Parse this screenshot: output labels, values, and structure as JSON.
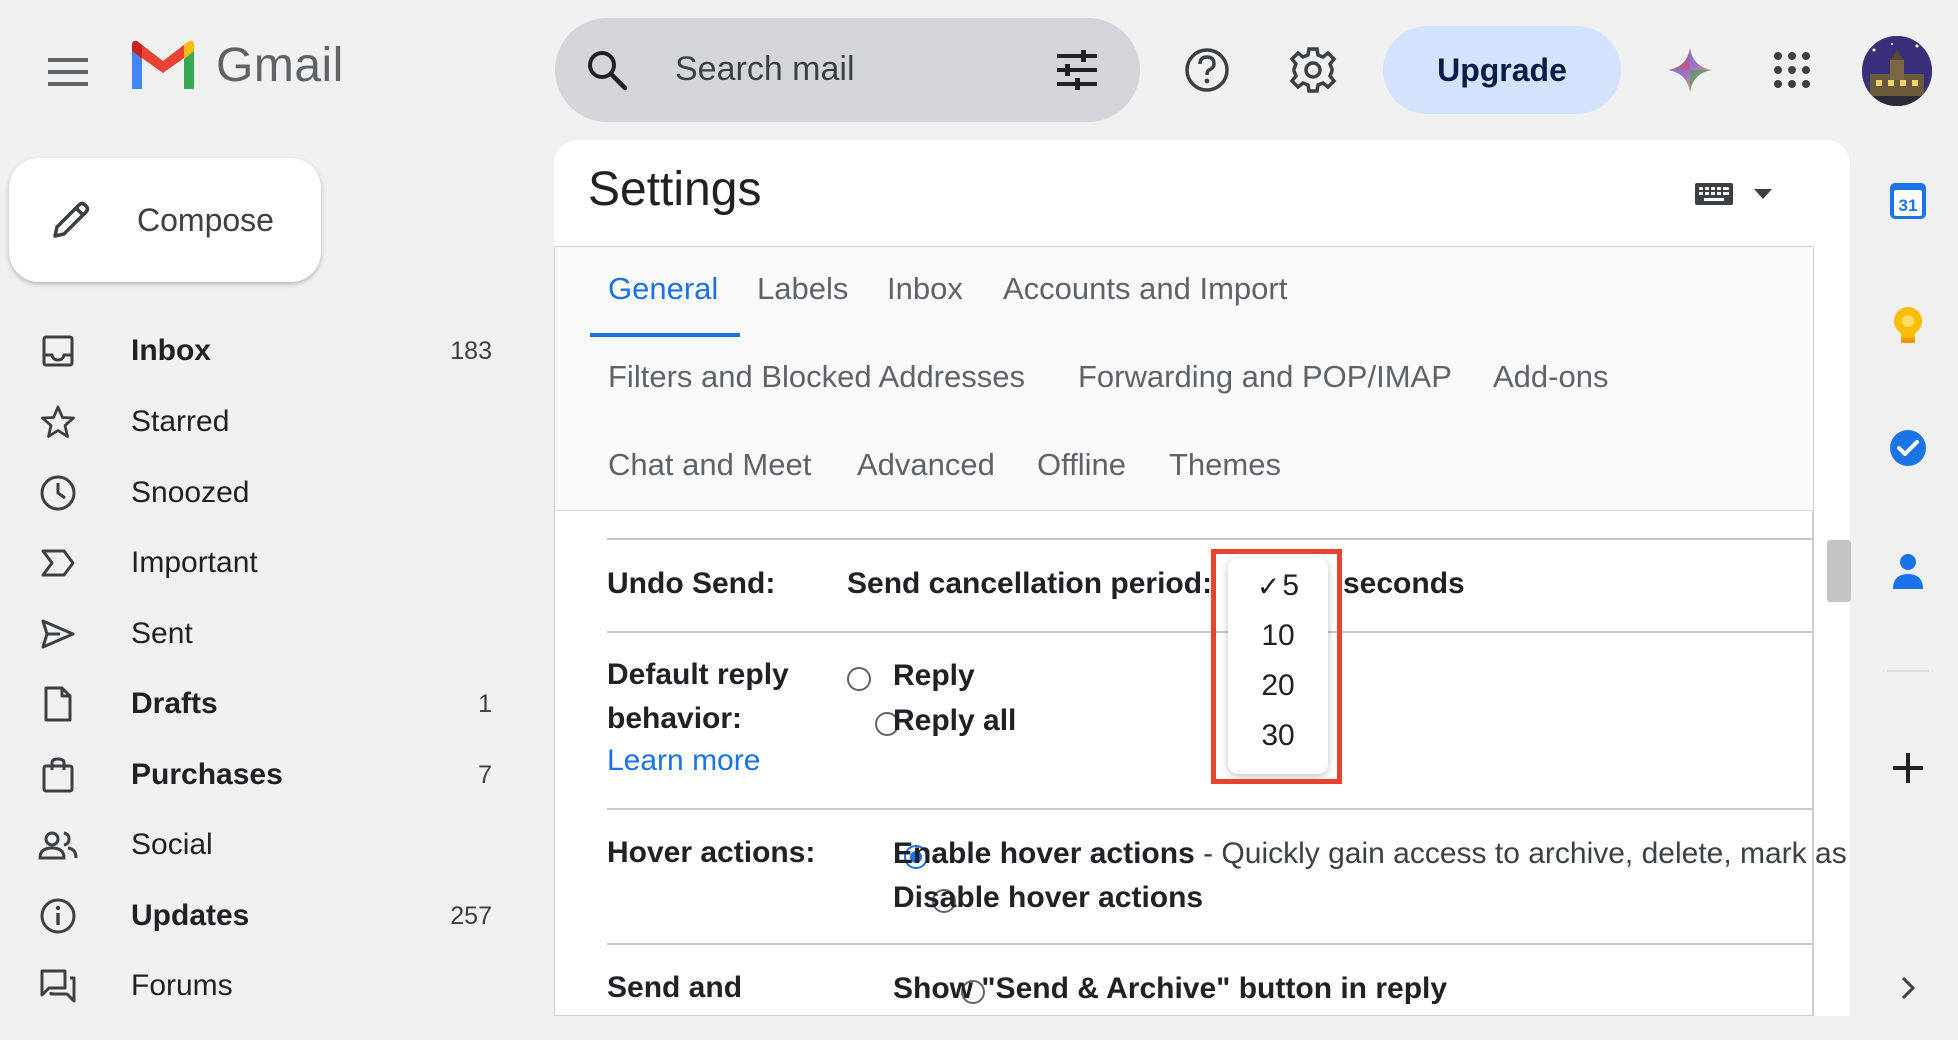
{
  "header": {
    "app_name": "Gmail",
    "search_placeholder": "Search mail",
    "upgrade_label": "Upgrade"
  },
  "compose": {
    "label": "Compose"
  },
  "sidebar": {
    "items": [
      {
        "label": "Inbox",
        "count": "183",
        "bold": true,
        "icon": "inbox-icon"
      },
      {
        "label": "Starred",
        "count": "",
        "bold": false,
        "icon": "star-icon"
      },
      {
        "label": "Snoozed",
        "count": "",
        "bold": false,
        "icon": "clock-icon"
      },
      {
        "label": "Important",
        "count": "",
        "bold": false,
        "icon": "important-icon"
      },
      {
        "label": "Sent",
        "count": "",
        "bold": false,
        "icon": "send-icon"
      },
      {
        "label": "Drafts",
        "count": "1",
        "bold": true,
        "icon": "draft-icon"
      },
      {
        "label": "Purchases",
        "count": "7",
        "bold": true,
        "icon": "shopping-bag-icon"
      },
      {
        "label": "Social",
        "count": "",
        "bold": false,
        "icon": "people-icon"
      },
      {
        "label": "Updates",
        "count": "257",
        "bold": true,
        "icon": "info-icon"
      },
      {
        "label": "Forums",
        "count": "",
        "bold": false,
        "icon": "forum-icon"
      }
    ]
  },
  "settings": {
    "title": "Settings",
    "tabs": [
      {
        "label": "General"
      },
      {
        "label": "Labels"
      },
      {
        "label": "Inbox"
      },
      {
        "label": "Accounts and Import"
      },
      {
        "label": "Filters and Blocked Addresses"
      },
      {
        "label": "Forwarding and POP/IMAP"
      },
      {
        "label": "Add-ons"
      },
      {
        "label": "Chat and Meet"
      },
      {
        "label": "Advanced"
      },
      {
        "label": "Offline"
      },
      {
        "label": "Themes"
      }
    ],
    "active_tab": "General",
    "undo_send": {
      "label": "Undo Send:",
      "prefix": "Send cancellation period:",
      "suffix": "seconds",
      "selected": "5",
      "options": [
        "5",
        "10",
        "20",
        "30"
      ],
      "checkmark": "✓"
    },
    "default_reply": {
      "label_line1": "Default reply",
      "label_line2": "behavior:",
      "learn_more": "Learn more",
      "options": [
        "Reply",
        "Reply all"
      ]
    },
    "hover_actions": {
      "label": "Hover actions:",
      "enable_label": "Enable hover actions",
      "enable_desc": " - Quickly gain access to archive, delete, mark as read, and snooze controls on hover.",
      "disable_label": "Disable hover actions"
    },
    "send_archive": {
      "label": "Send and",
      "option": "Show \"Send & Archive\" button in reply"
    }
  },
  "right_rail": {
    "calendar_day": "31",
    "items": [
      "calendar-icon",
      "keep-icon",
      "tasks-icon",
      "contacts-icon",
      "add-icon"
    ]
  },
  "colors": {
    "accent": "#1a73e8",
    "upgrade_bg": "#d3e3fd",
    "highlight": "#e8432e",
    "gmail_red": "#ea4335"
  }
}
